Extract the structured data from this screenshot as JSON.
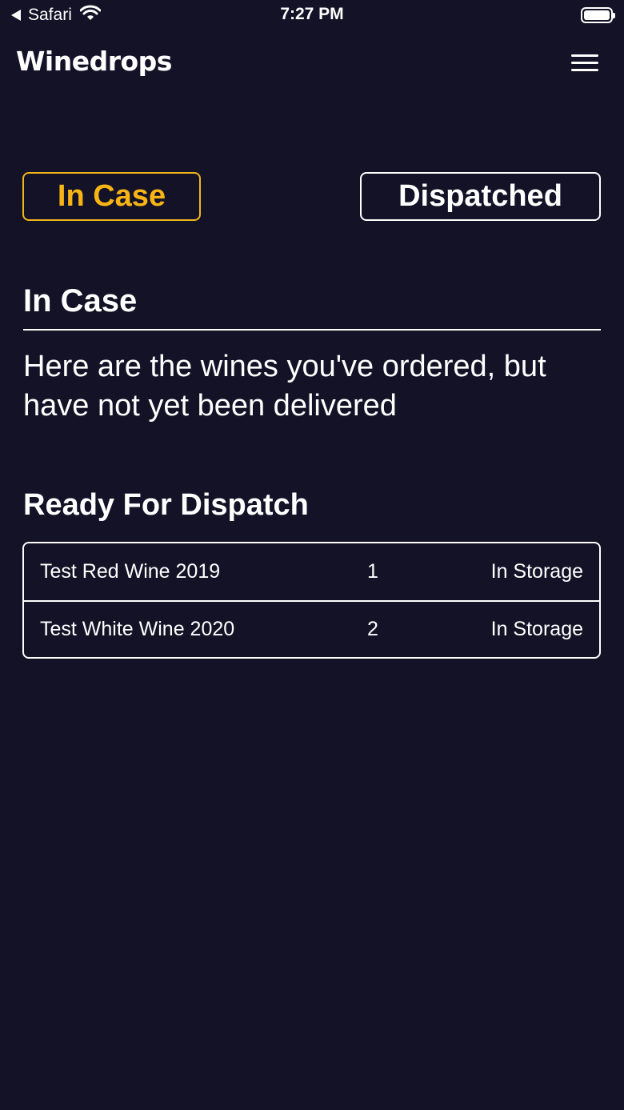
{
  "status_bar": {
    "back_app": "Safari",
    "time": "7:27 PM"
  },
  "header": {
    "logo": "Winedrops",
    "menu_icon": "hamburger-menu-icon"
  },
  "tabs": [
    {
      "label": "In Case",
      "active": true
    },
    {
      "label": "Dispatched",
      "active": false
    }
  ],
  "section": {
    "title": "In Case",
    "description": "Here are the wines you've ordered, but have not yet been delivered"
  },
  "ready": {
    "heading": "Ready For Dispatch",
    "rows": [
      {
        "name": "Test Red Wine 2019",
        "qty": "1",
        "status": "In Storage"
      },
      {
        "name": "Test White Wine 2020",
        "qty": "2",
        "status": "In Storage"
      }
    ]
  },
  "colors": {
    "background": "#141226",
    "accent": "#f7b515",
    "text": "#ffffff"
  }
}
